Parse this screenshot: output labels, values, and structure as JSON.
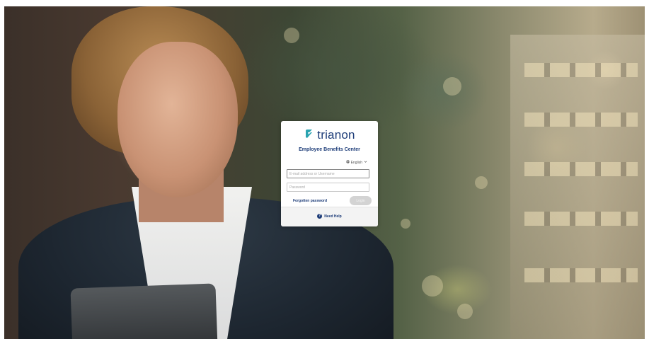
{
  "brand": {
    "name": "trianon",
    "color": "#1d3c78",
    "icon_color": "#2aa3b0",
    "logo_icon": "trianon-logo-icon"
  },
  "card": {
    "subtitle": "Employee Benefits Center"
  },
  "language": {
    "icon": "globe-icon",
    "selected": "English",
    "dropdown_icon": "chevron-down-icon"
  },
  "form": {
    "username": {
      "value": "",
      "placeholder": "E-mail address or Username"
    },
    "password": {
      "value": "",
      "placeholder": "Password"
    },
    "forgot_label": "Forgotten password",
    "login_label": "Login"
  },
  "footer": {
    "help_icon": "question-circle-icon",
    "help_label": "Need Help"
  }
}
